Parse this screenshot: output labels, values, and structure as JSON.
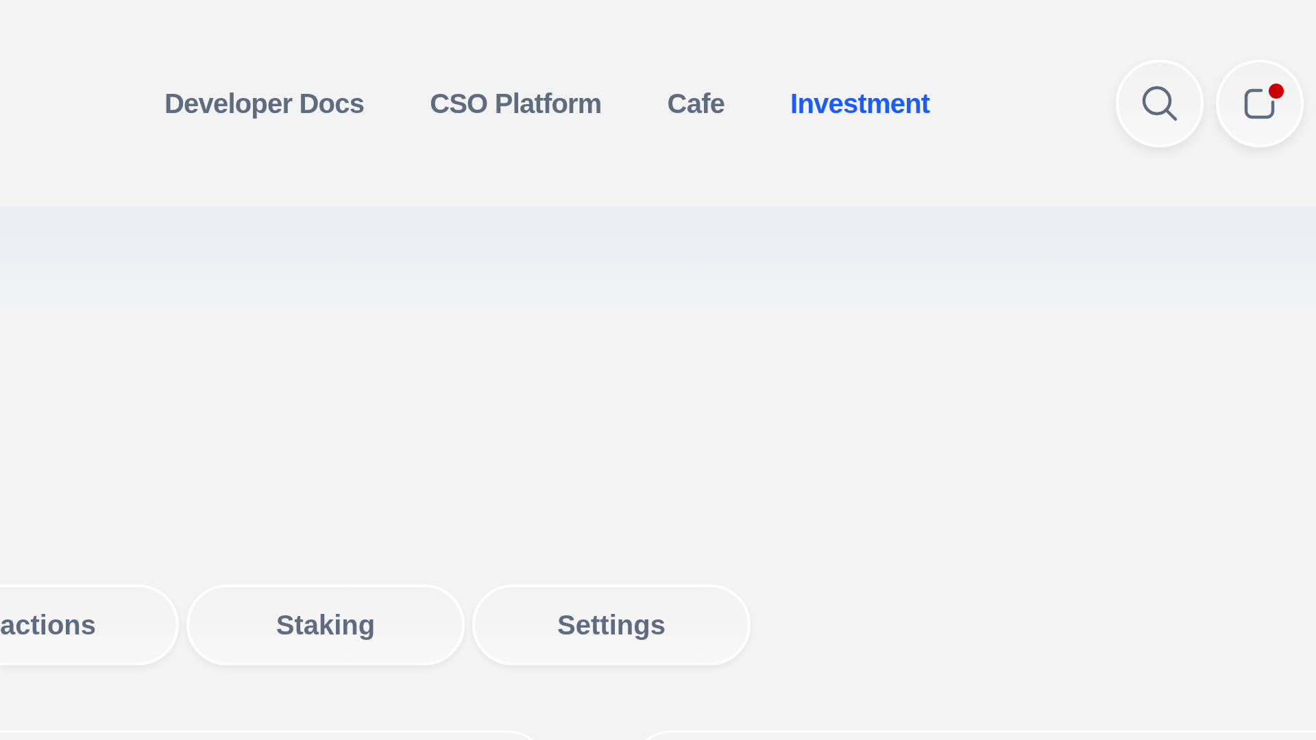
{
  "nav": {
    "links": [
      {
        "label": "Developer Docs",
        "selected": false
      },
      {
        "label": "CSO Platform",
        "selected": false
      },
      {
        "label": "Cafe",
        "selected": false
      },
      {
        "label": "Investment",
        "selected": true
      }
    ]
  },
  "header_actions": [
    {
      "kind": "search"
    },
    {
      "kind": "notifications",
      "unread": true
    }
  ],
  "tabs": [
    {
      "label": "actions",
      "selected": false
    },
    {
      "label": "Staking",
      "selected": false
    },
    {
      "label": "Settings",
      "selected": false
    }
  ]
}
